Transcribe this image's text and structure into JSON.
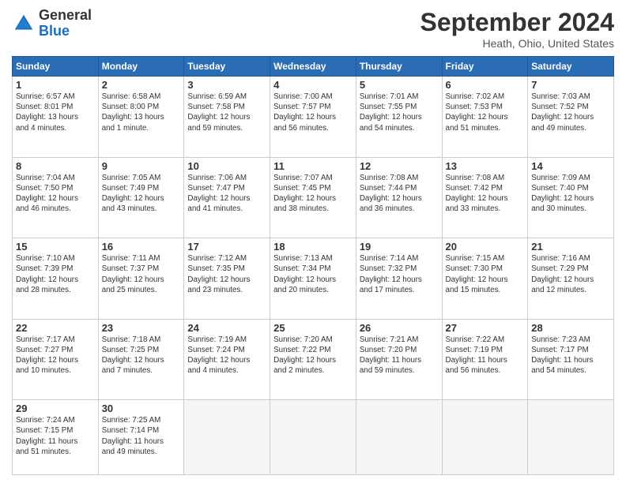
{
  "header": {
    "logo_general": "General",
    "logo_blue": "Blue",
    "month": "September 2024",
    "location": "Heath, Ohio, United States"
  },
  "weekdays": [
    "Sunday",
    "Monday",
    "Tuesday",
    "Wednesday",
    "Thursday",
    "Friday",
    "Saturday"
  ],
  "weeks": [
    [
      {
        "day": "1",
        "info": "Sunrise: 6:57 AM\nSunset: 8:01 PM\nDaylight: 13 hours\nand 4 minutes."
      },
      {
        "day": "2",
        "info": "Sunrise: 6:58 AM\nSunset: 8:00 PM\nDaylight: 13 hours\nand 1 minute."
      },
      {
        "day": "3",
        "info": "Sunrise: 6:59 AM\nSunset: 7:58 PM\nDaylight: 12 hours\nand 59 minutes."
      },
      {
        "day": "4",
        "info": "Sunrise: 7:00 AM\nSunset: 7:57 PM\nDaylight: 12 hours\nand 56 minutes."
      },
      {
        "day": "5",
        "info": "Sunrise: 7:01 AM\nSunset: 7:55 PM\nDaylight: 12 hours\nand 54 minutes."
      },
      {
        "day": "6",
        "info": "Sunrise: 7:02 AM\nSunset: 7:53 PM\nDaylight: 12 hours\nand 51 minutes."
      },
      {
        "day": "7",
        "info": "Sunrise: 7:03 AM\nSunset: 7:52 PM\nDaylight: 12 hours\nand 49 minutes."
      }
    ],
    [
      {
        "day": "8",
        "info": "Sunrise: 7:04 AM\nSunset: 7:50 PM\nDaylight: 12 hours\nand 46 minutes."
      },
      {
        "day": "9",
        "info": "Sunrise: 7:05 AM\nSunset: 7:49 PM\nDaylight: 12 hours\nand 43 minutes."
      },
      {
        "day": "10",
        "info": "Sunrise: 7:06 AM\nSunset: 7:47 PM\nDaylight: 12 hours\nand 41 minutes."
      },
      {
        "day": "11",
        "info": "Sunrise: 7:07 AM\nSunset: 7:45 PM\nDaylight: 12 hours\nand 38 minutes."
      },
      {
        "day": "12",
        "info": "Sunrise: 7:08 AM\nSunset: 7:44 PM\nDaylight: 12 hours\nand 36 minutes."
      },
      {
        "day": "13",
        "info": "Sunrise: 7:08 AM\nSunset: 7:42 PM\nDaylight: 12 hours\nand 33 minutes."
      },
      {
        "day": "14",
        "info": "Sunrise: 7:09 AM\nSunset: 7:40 PM\nDaylight: 12 hours\nand 30 minutes."
      }
    ],
    [
      {
        "day": "15",
        "info": "Sunrise: 7:10 AM\nSunset: 7:39 PM\nDaylight: 12 hours\nand 28 minutes."
      },
      {
        "day": "16",
        "info": "Sunrise: 7:11 AM\nSunset: 7:37 PM\nDaylight: 12 hours\nand 25 minutes."
      },
      {
        "day": "17",
        "info": "Sunrise: 7:12 AM\nSunset: 7:35 PM\nDaylight: 12 hours\nand 23 minutes."
      },
      {
        "day": "18",
        "info": "Sunrise: 7:13 AM\nSunset: 7:34 PM\nDaylight: 12 hours\nand 20 minutes."
      },
      {
        "day": "19",
        "info": "Sunrise: 7:14 AM\nSunset: 7:32 PM\nDaylight: 12 hours\nand 17 minutes."
      },
      {
        "day": "20",
        "info": "Sunrise: 7:15 AM\nSunset: 7:30 PM\nDaylight: 12 hours\nand 15 minutes."
      },
      {
        "day": "21",
        "info": "Sunrise: 7:16 AM\nSunset: 7:29 PM\nDaylight: 12 hours\nand 12 minutes."
      }
    ],
    [
      {
        "day": "22",
        "info": "Sunrise: 7:17 AM\nSunset: 7:27 PM\nDaylight: 12 hours\nand 10 minutes."
      },
      {
        "day": "23",
        "info": "Sunrise: 7:18 AM\nSunset: 7:25 PM\nDaylight: 12 hours\nand 7 minutes."
      },
      {
        "day": "24",
        "info": "Sunrise: 7:19 AM\nSunset: 7:24 PM\nDaylight: 12 hours\nand 4 minutes."
      },
      {
        "day": "25",
        "info": "Sunrise: 7:20 AM\nSunset: 7:22 PM\nDaylight: 12 hours\nand 2 minutes."
      },
      {
        "day": "26",
        "info": "Sunrise: 7:21 AM\nSunset: 7:20 PM\nDaylight: 11 hours\nand 59 minutes."
      },
      {
        "day": "27",
        "info": "Sunrise: 7:22 AM\nSunset: 7:19 PM\nDaylight: 11 hours\nand 56 minutes."
      },
      {
        "day": "28",
        "info": "Sunrise: 7:23 AM\nSunset: 7:17 PM\nDaylight: 11 hours\nand 54 minutes."
      }
    ],
    [
      {
        "day": "29",
        "info": "Sunrise: 7:24 AM\nSunset: 7:15 PM\nDaylight: 11 hours\nand 51 minutes."
      },
      {
        "day": "30",
        "info": "Sunrise: 7:25 AM\nSunset: 7:14 PM\nDaylight: 11 hours\nand 49 minutes."
      },
      {
        "day": "",
        "info": ""
      },
      {
        "day": "",
        "info": ""
      },
      {
        "day": "",
        "info": ""
      },
      {
        "day": "",
        "info": ""
      },
      {
        "day": "",
        "info": ""
      }
    ]
  ]
}
